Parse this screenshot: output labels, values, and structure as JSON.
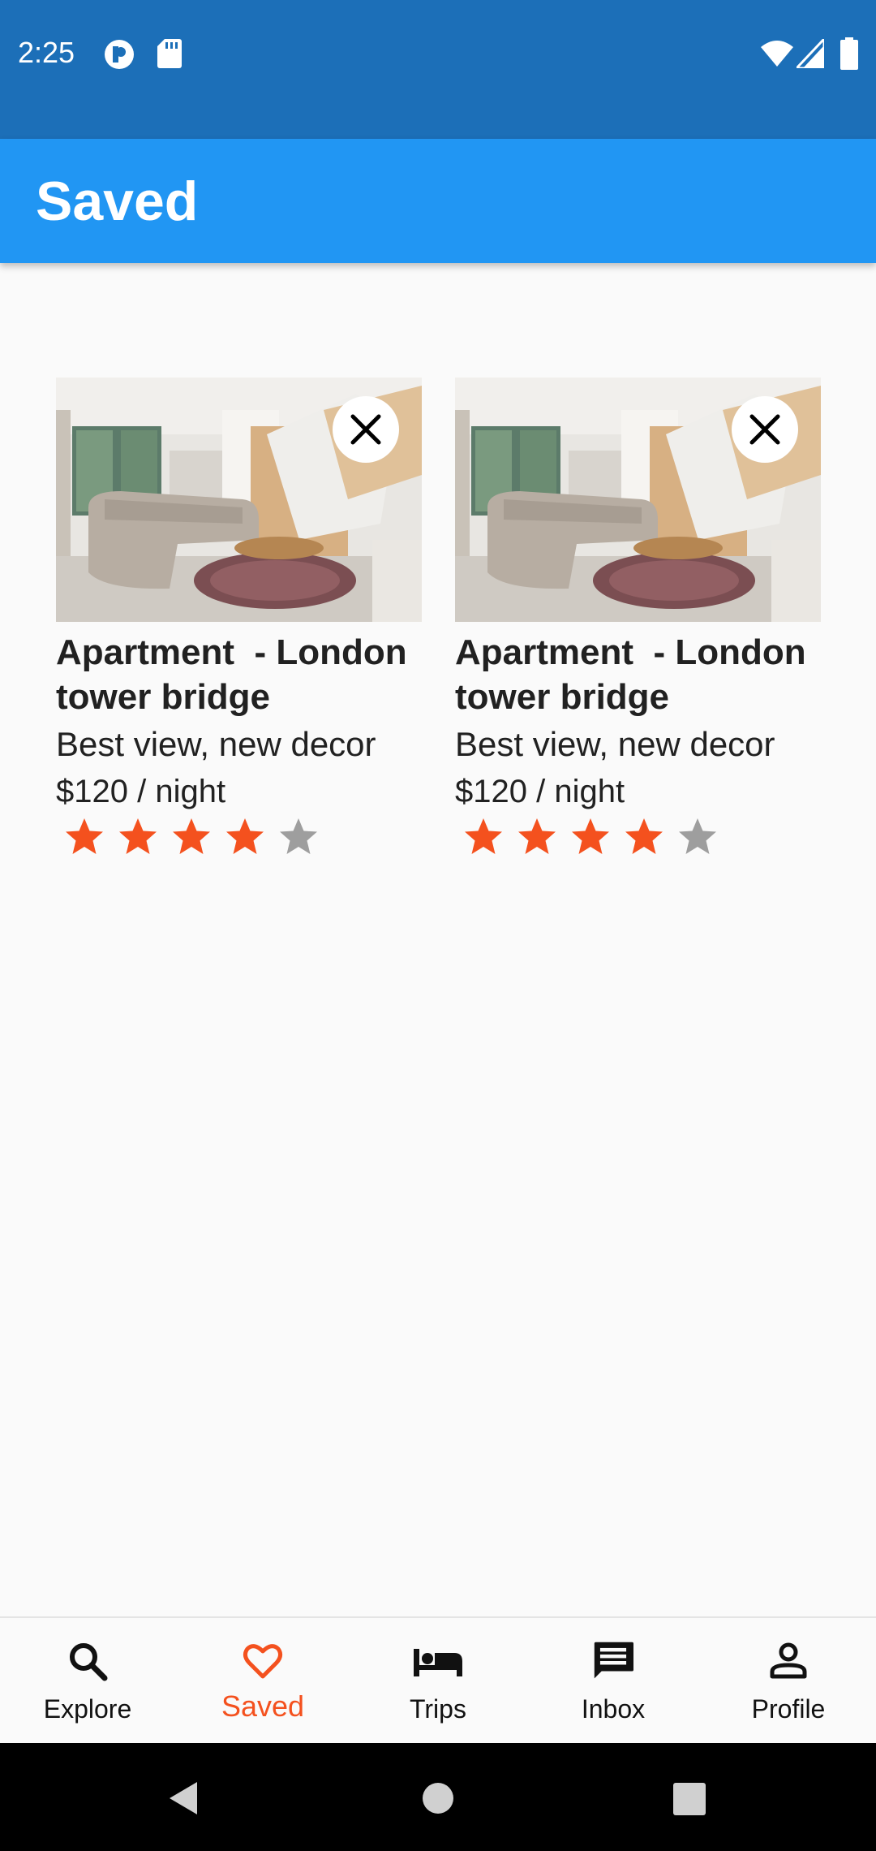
{
  "status_bar": {
    "time": "2:25"
  },
  "app_bar": {
    "title": "Saved"
  },
  "listings": [
    {
      "name": "Apartment  - London tower bridge",
      "description": "Best view, new decor",
      "price": "$120 / night",
      "rating": 4,
      "max_rating": 5
    },
    {
      "name": "Apartment  - London tower bridge",
      "description": "Best view, new decor",
      "price": "$120 / night",
      "rating": 4,
      "max_rating": 5
    }
  ],
  "bottom_nav": {
    "items": [
      {
        "label": "Explore",
        "icon": "search-icon"
      },
      {
        "label": "Saved",
        "icon": "heart-icon",
        "active": true
      },
      {
        "label": "Trips",
        "icon": "bed-icon"
      },
      {
        "label": "Inbox",
        "icon": "message-icon"
      },
      {
        "label": "Profile",
        "icon": "person-icon"
      }
    ]
  },
  "colors": {
    "status_bar": "#1c6fb8",
    "app_bar": "#2196f3",
    "accent": "#f4511e",
    "star_filled": "#f4511e",
    "star_empty": "#9e9e9e"
  }
}
